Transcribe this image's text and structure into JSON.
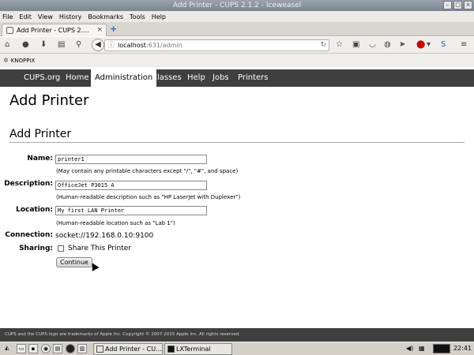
{
  "window": {
    "title": "Add Printer - CUPS 2.1.2 - Iceweasel",
    "minimize": "–",
    "maximize": "□",
    "close": "×"
  },
  "menu": {
    "items": [
      "File",
      "Edit",
      "View",
      "History",
      "Bookmarks",
      "Tools",
      "Help"
    ]
  },
  "tab": {
    "title": "Add Printer - CUPS 2....",
    "close": "×",
    "new_tab": "+"
  },
  "nav": {
    "url_host": "localhost",
    "url_path": ":631/admin"
  },
  "bookmarks": {
    "items": [
      "KNOPPIX"
    ]
  },
  "cups_nav": {
    "items": [
      "CUPS.org",
      "Home",
      "Administration",
      "Classes",
      "Help",
      "Jobs",
      "Printers"
    ],
    "active": "Administration"
  },
  "page": {
    "title": "Add Printer",
    "section_title": "Add Printer"
  },
  "form": {
    "name_label": "Name:",
    "name_value": "printer1",
    "name_hint": "(May contain any printable characters except \"/\", \"#\", and space)",
    "description_label": "Description:",
    "description_value": "OfficeJet P3015 A",
    "description_hint": "(Human-readable description such as \"HP LaserJet with Duplexer\")",
    "location_label": "Location:",
    "location_value": "My first LAN Printer",
    "location_hint": "(Human-readable location such as \"Lab 1\")",
    "connection_label": "Connection:",
    "connection_value": "socket://192.168.0.10:9100",
    "sharing_label": "Sharing:",
    "sharing_checkbox_label": "Share This Printer",
    "sharing_checked": false,
    "continue_label": "Continue"
  },
  "footer": {
    "text": "CUPS and the CUPS logo are trademarks of Apple Inc. Copyright © 2007-2015 Apple Inc. All rights reserved."
  },
  "taskbar": {
    "tasks": [
      "Add Printer - CU...",
      "LXTerminal"
    ],
    "clock": "22:41"
  },
  "colors": {
    "cups_nav_bg": "#3f3f3f",
    "footer_bg": "#3f3f3f",
    "taskbar_bg": "#d4d0c8"
  }
}
